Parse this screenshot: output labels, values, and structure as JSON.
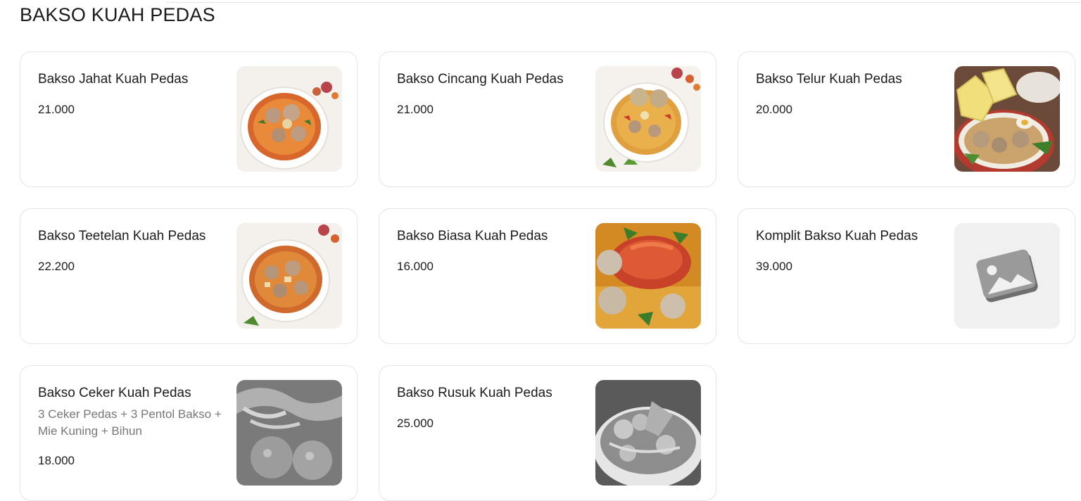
{
  "section": {
    "title": "BAKSO KUAH PEDAS"
  },
  "items": [
    {
      "name": "Bakso Jahat Kuah Pedas",
      "price": "21.000",
      "image": "spicy-meatball-soup-photo"
    },
    {
      "name": "Bakso Cincang Kuah Pedas",
      "price": "21.000",
      "image": "spicy-meatball-soup-photo"
    },
    {
      "name": "Bakso Telur Kuah Pedas",
      "price": "20.000",
      "image": "egg-meatball-soup-photo"
    },
    {
      "name": "Bakso Teetelan Kuah Pedas",
      "price": "22.200",
      "image": "spicy-meatball-soup-photo"
    },
    {
      "name": "Bakso Biasa Kuah Pedas",
      "price": "16.000",
      "image": "spicy-meatball-soup-photo"
    },
    {
      "name": "Komplit Bakso Kuah Pedas",
      "price": "39.000",
      "image": "image-placeholder-icon"
    },
    {
      "name": "Bakso Ceker Kuah Pedas",
      "description": "3 Ceker Pedas + 3 Pentol Bakso + Mie Kuning + Bihun",
      "price": "18.000",
      "image": "grayscale-chicken-feet-soup-photo"
    },
    {
      "name": "Bakso Rusuk Kuah Pedas",
      "price": "25.000",
      "image": "grayscale-rib-meatball-soup-photo"
    }
  ],
  "colors": {
    "card_border": "#e4e4e4",
    "text_primary": "#1c1c1c",
    "text_secondary": "#777777",
    "placeholder_bg": "#f0f0f0"
  }
}
